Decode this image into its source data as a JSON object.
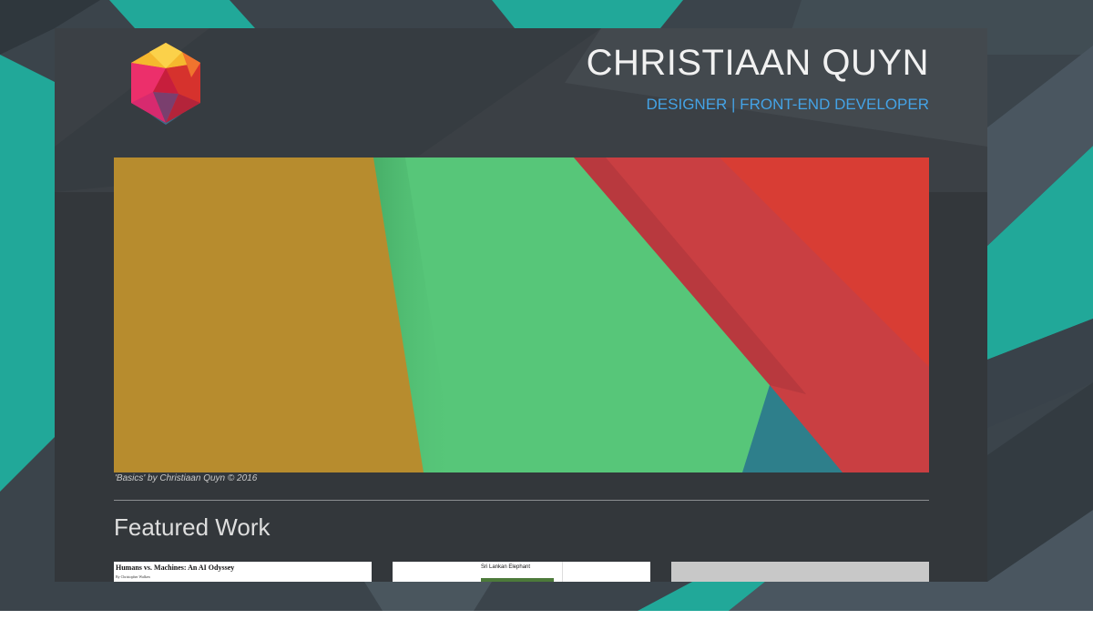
{
  "header": {
    "name": "CHRISTIAAN QUYN",
    "tagline": "DESIGNER | FRONT-END DEVELOPER"
  },
  "hero": {
    "caption": "'Basics' by Christiaan Quyn © 2016"
  },
  "featured": {
    "heading": "Featured Work",
    "items": [
      {
        "title": "Humans vs. Machines: An AI Odyssey",
        "byline": "By Christopher Walken"
      },
      {
        "title": "Sri Lankan Elephant"
      },
      {
        "title": ""
      }
    ]
  },
  "colors": {
    "teal": "#21a899",
    "page_background": "#3a4249",
    "card": "#33373b",
    "accent_blue": "#44a3e6",
    "hero_gold": "#b78c2e",
    "hero_green": "#57c679",
    "hero_red": "#c93f42"
  },
  "icons": [
    "hexagon-logo-icon"
  ]
}
